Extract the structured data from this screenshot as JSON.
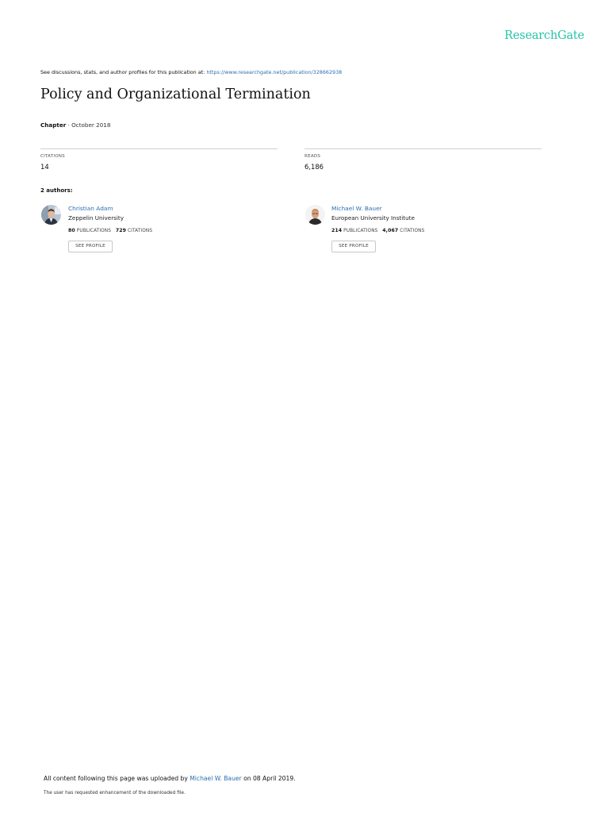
{
  "logo": "ResearchGate",
  "discussion": {
    "text": "See discussions, stats, and author profiles for this publication at: ",
    "url": "https://www.researchgate.net/publication/328662938"
  },
  "title": "Policy and Organizational Termination",
  "meta": {
    "type": "Chapter",
    "date": " · October 2018"
  },
  "stats": {
    "citations": {
      "label": "CITATIONS",
      "value": "14"
    },
    "reads": {
      "label": "READS",
      "value": "6,186"
    }
  },
  "authors_label": "2 authors:",
  "authors": [
    {
      "name": "Christian Adam",
      "institution": "Zeppelin University",
      "publications": "80",
      "publications_label": "PUBLICATIONS",
      "citations": "729",
      "citations_label": "CITATIONS",
      "button": "SEE PROFILE"
    },
    {
      "name": "Michael W. Bauer",
      "institution": "European University Institute",
      "publications": "214",
      "publications_label": "PUBLICATIONS",
      "citations": "4,067",
      "citations_label": "CITATIONS",
      "button": "SEE PROFILE"
    }
  ],
  "footer": {
    "prefix": "All content following this page was uploaded by ",
    "uploader": "Michael W. Bauer",
    "suffix": " on 08 April 2019.",
    "note": "The user has requested enhancement of the downloaded file."
  },
  "colors": {
    "brand": "#26c4a8",
    "link": "#2a6fb0"
  }
}
